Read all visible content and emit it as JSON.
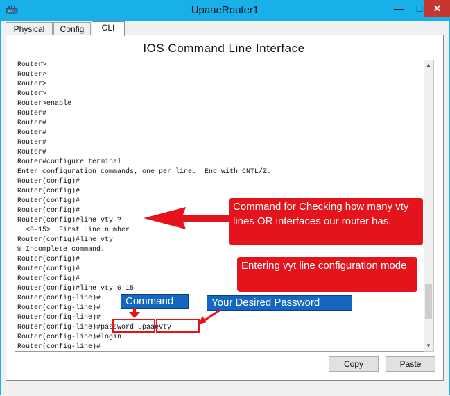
{
  "window": {
    "title": "UpaaeRouter1",
    "minimize": "—",
    "maximize": "□",
    "close": "✕"
  },
  "tabs": [
    {
      "label": "Physical",
      "active": false
    },
    {
      "label": "Config",
      "active": false
    },
    {
      "label": "CLI",
      "active": true
    }
  ],
  "heading": "IOS Command Line Interface",
  "console_lines": [
    "Router>",
    "Router>",
    "Router>",
    "Router>",
    "Router>enable",
    "Router#",
    "Router#",
    "Router#",
    "Router#",
    "Router#",
    "Router#configure terminal",
    "Enter configuration commands, one per line.  End with CNTL/Z.",
    "Router(config)#",
    "Router(config)#",
    "Router(config)#",
    "Router(config)#",
    "Router(config)#line vty ?",
    "  <0-15>  First Line number",
    "Router(config)#line vty",
    "% Incomplete command.",
    "Router(config)#",
    "Router(config)#",
    "Router(config)#",
    "Router(config)#line vty 0 15",
    "Router(config-line)#",
    "Router(config-line)#",
    "Router(config-line)#",
    "Router(config-line)#password upaaeVty",
    "Router(config-line)#login",
    "Router(config-line)#"
  ],
  "annotations": {
    "callout_check": "Command for Checking how many vty lines OR interfaces our router has.",
    "callout_mode": "Entering vyt line configuration mode",
    "label_command": "Command",
    "label_password": "Your Desired Password",
    "color_red": "#e5141c",
    "color_blue": "#1566c0"
  },
  "buttons": {
    "copy": "Copy",
    "paste": "Paste"
  }
}
